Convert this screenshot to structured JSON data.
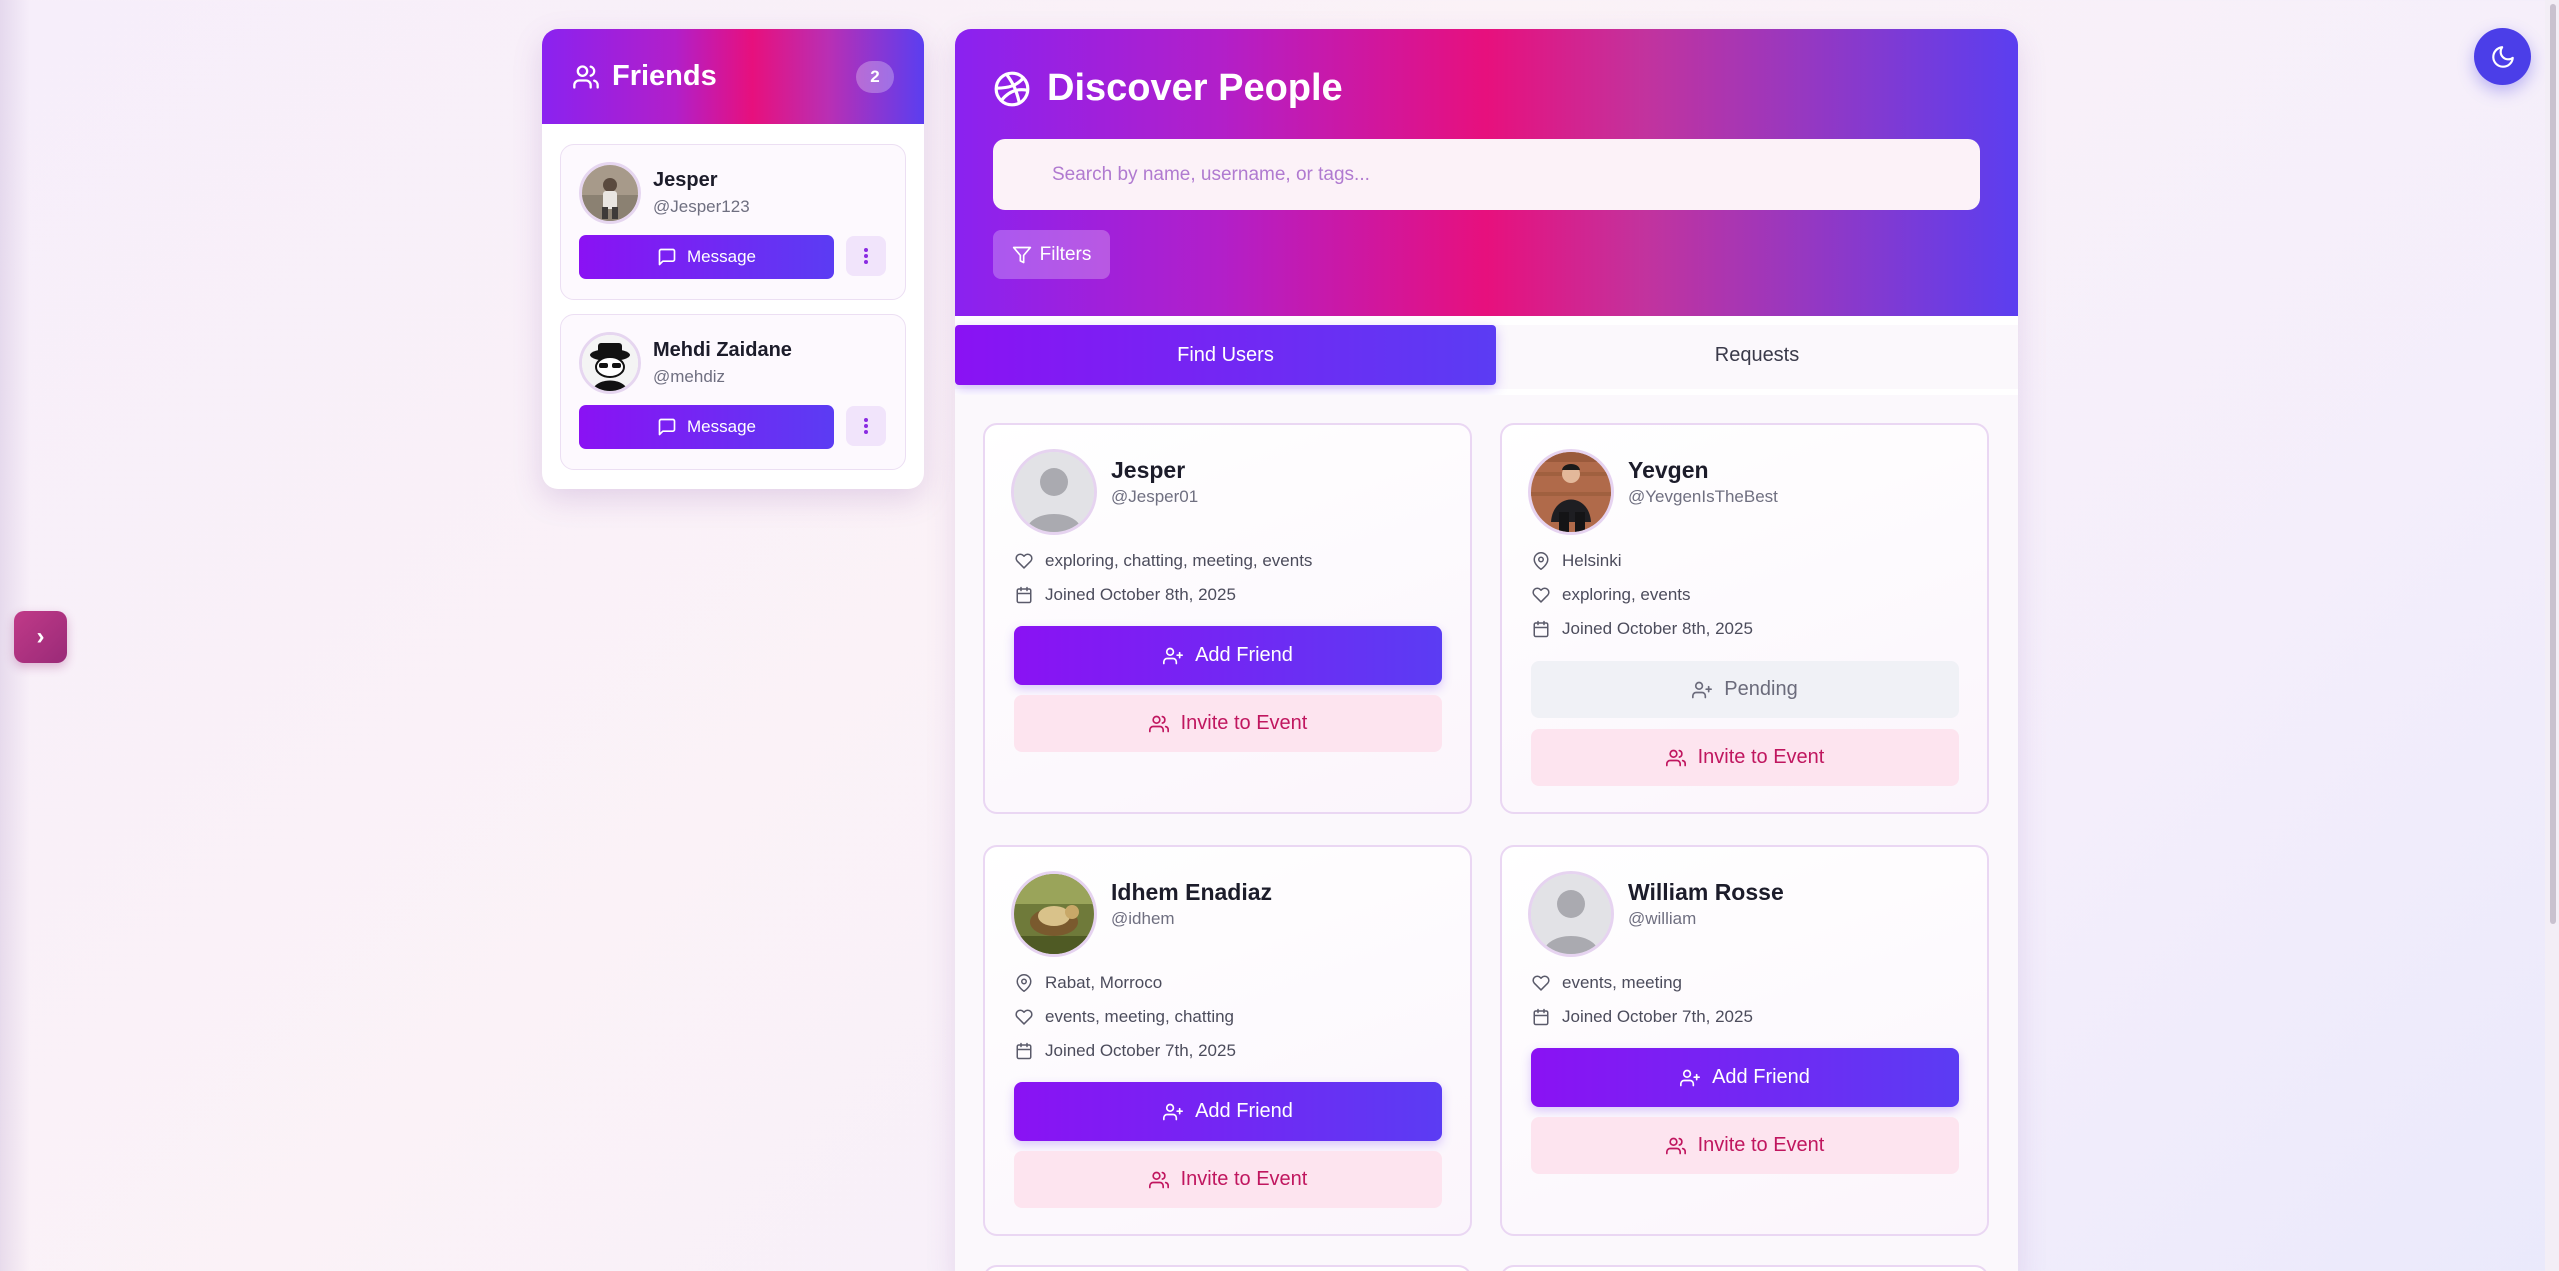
{
  "friends_panel": {
    "title": "Friends",
    "count": "2",
    "friends": [
      {
        "name": "Jesper",
        "handle": "@Jesper123",
        "message_label": "Message"
      },
      {
        "name": "Mehdi Zaidane",
        "handle": "@mehdiz",
        "message_label": "Message"
      }
    ]
  },
  "discover": {
    "title": "Discover People",
    "search_placeholder": "Search by name, username, or tags...",
    "search_value": "",
    "filters_label": "Filters",
    "tabs": [
      {
        "label": "Find Users",
        "active": true
      },
      {
        "label": "Requests",
        "active": false
      }
    ],
    "users": [
      {
        "name": "Jesper",
        "handle": "@Jesper01",
        "location": "",
        "interests": "exploring, chatting, meeting, events",
        "joined": "Joined October 8th, 2025",
        "primary_action": "Add Friend",
        "invite_label": "Invite to Event"
      },
      {
        "name": "Yevgen",
        "handle": "@YevgenIsTheBest",
        "location": "Helsinki",
        "interests": "exploring, events",
        "joined": "Joined October 8th, 2025",
        "primary_action": "Pending",
        "invite_label": "Invite to Event"
      },
      {
        "name": "Idhem Enadiaz",
        "handle": "@idhem",
        "location": "Rabat, Morroco",
        "interests": "events, meeting, chatting",
        "joined": "Joined October 7th, 2025",
        "primary_action": "Add Friend",
        "invite_label": "Invite to Event"
      },
      {
        "name": "William Rosse",
        "handle": "@william",
        "location": "",
        "interests": "events, meeting",
        "joined": "Joined October 7th, 2025",
        "primary_action": "Add Friend",
        "invite_label": "Invite to Event"
      }
    ]
  },
  "side_toggle": {
    "glyph": "›"
  },
  "colors": {
    "accent_purple": "#8a12f3",
    "accent_indigo": "#5b3cf3",
    "accent_pink": "#e7107d",
    "invite_text": "#c0165f",
    "invite_bg": "#fde4ef"
  },
  "icons": [
    "users-icon",
    "message-icon",
    "more-vertical-icon",
    "dribbble-icon",
    "filter-icon",
    "map-pin-icon",
    "heart-icon",
    "calendar-icon",
    "user-plus-icon",
    "moon-icon",
    "chevron-right-icon"
  ]
}
